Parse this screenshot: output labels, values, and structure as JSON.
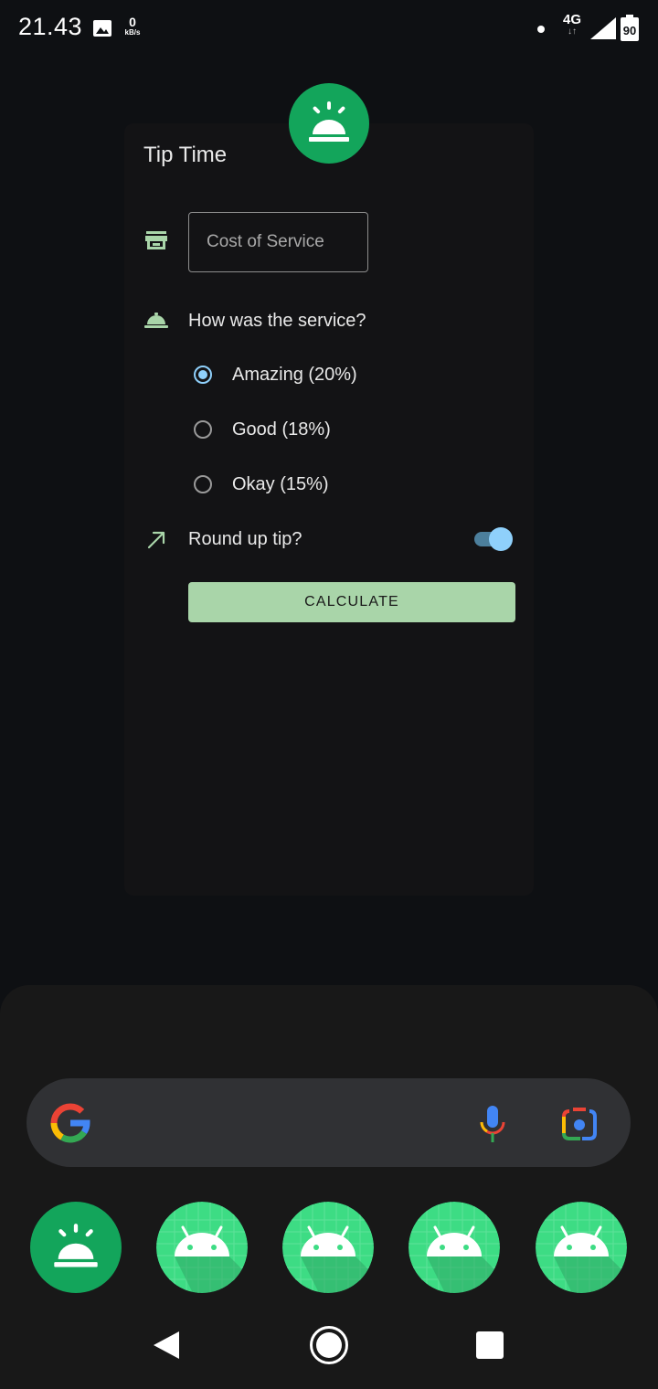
{
  "status_bar": {
    "time": "21.43",
    "net_speed_value": "0",
    "net_speed_unit": "kB/s",
    "network_type": "4G",
    "battery": "90",
    "icons": [
      "image-icon",
      "dot-icon",
      "signal-icon",
      "battery-icon"
    ]
  },
  "app": {
    "title": "Tip Time",
    "cost_placeholder": "Cost of Service",
    "question": "How was the service?",
    "options": [
      {
        "label": "Amazing (20%)",
        "selected": true
      },
      {
        "label": "Good (18%)",
        "selected": false
      },
      {
        "label": "Okay (15%)",
        "selected": false
      }
    ],
    "round_up_label": "Round up tip?",
    "round_up_enabled": true,
    "calculate_label": "CALCULATE"
  },
  "launcher": {
    "search_icons": [
      "google-logo-icon",
      "microphone-icon",
      "lens-camera-icon"
    ],
    "dock": [
      "tip-time-app-icon",
      "android-app-icon",
      "android-app-icon",
      "android-app-icon",
      "android-app-icon"
    ]
  },
  "colors": {
    "accent_green": "#13a55b",
    "button_green": "#a9d5a9",
    "radio_blue": "#8fd0fb",
    "background": "#0e1013"
  }
}
